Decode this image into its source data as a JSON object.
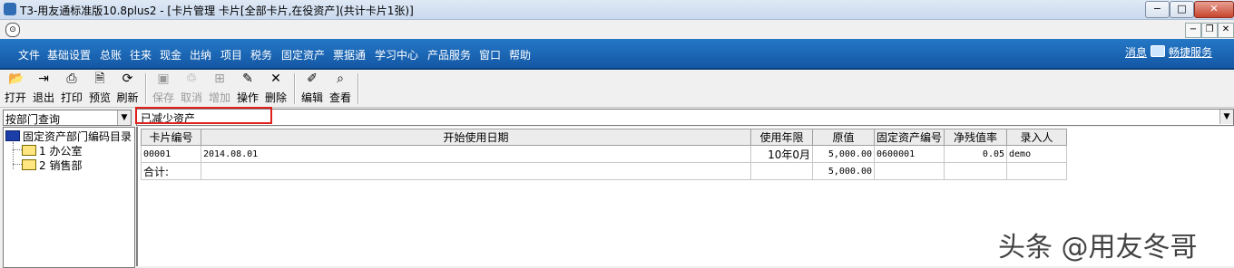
{
  "window": {
    "title": "T3-用友通标准版10.8plus2 - [卡片管理 卡片[全部卡片,在役资产](共计卡片1张)]",
    "controls": {
      "minimize": "−",
      "maximize": "□",
      "close": "✕"
    }
  },
  "mdi_controls": {
    "minimize": "−",
    "restore": "❐",
    "close": "✕"
  },
  "menu": {
    "items": [
      "文件",
      "基础设置",
      "总账",
      "往来",
      "现金",
      "出纳",
      "项目",
      "税务",
      "固定资产",
      "票据通",
      "学习中心",
      "产品服务",
      "窗口",
      "帮助"
    ],
    "right": {
      "message": "消息",
      "quick_service": "畅捷服务"
    }
  },
  "toolbar": {
    "buttons": [
      {
        "label": "打开",
        "icon": "open-folder-icon",
        "enabled": true
      },
      {
        "label": "退出",
        "icon": "exit-icon",
        "enabled": true
      },
      {
        "label": "打印",
        "icon": "printer-icon",
        "enabled": true
      },
      {
        "label": "预览",
        "icon": "preview-icon",
        "enabled": true
      },
      {
        "label": "刷新",
        "icon": "refresh-icon",
        "enabled": true
      },
      {
        "label": "保存",
        "icon": "save-icon",
        "enabled": false
      },
      {
        "label": "取消",
        "icon": "cancel-icon",
        "enabled": false
      },
      {
        "label": "增加",
        "icon": "add-icon",
        "enabled": false
      },
      {
        "label": "操作",
        "icon": "operation-icon",
        "enabled": true
      },
      {
        "label": "删除",
        "icon": "delete-icon",
        "enabled": true
      },
      {
        "label": "编辑",
        "icon": "edit-icon",
        "enabled": true
      },
      {
        "label": "查看",
        "icon": "view-icon",
        "enabled": true
      }
    ]
  },
  "filter": {
    "dept_query": "按部门查询",
    "asset_status": "已减少资产"
  },
  "tree": {
    "root": "固定资产部门编码目录",
    "children": [
      "1 办公室",
      "2 销售部"
    ]
  },
  "grid": {
    "columns": [
      "卡片编号",
      "开始使用日期",
      "使用年限",
      "原值",
      "固定资产编号",
      "净残值率",
      "录入人"
    ],
    "rows": [
      [
        "00001",
        "2014.08.01",
        "10年0月",
        "5,000.00",
        "0600001",
        "0.05",
        "demo"
      ]
    ],
    "total": {
      "label": "合计:",
      "original_value": "5,000.00"
    }
  },
  "watermark": "头条 @用友冬哥",
  "colors": {
    "menu_bar": "#1a64b4",
    "highlight_border": "#e0201b"
  }
}
